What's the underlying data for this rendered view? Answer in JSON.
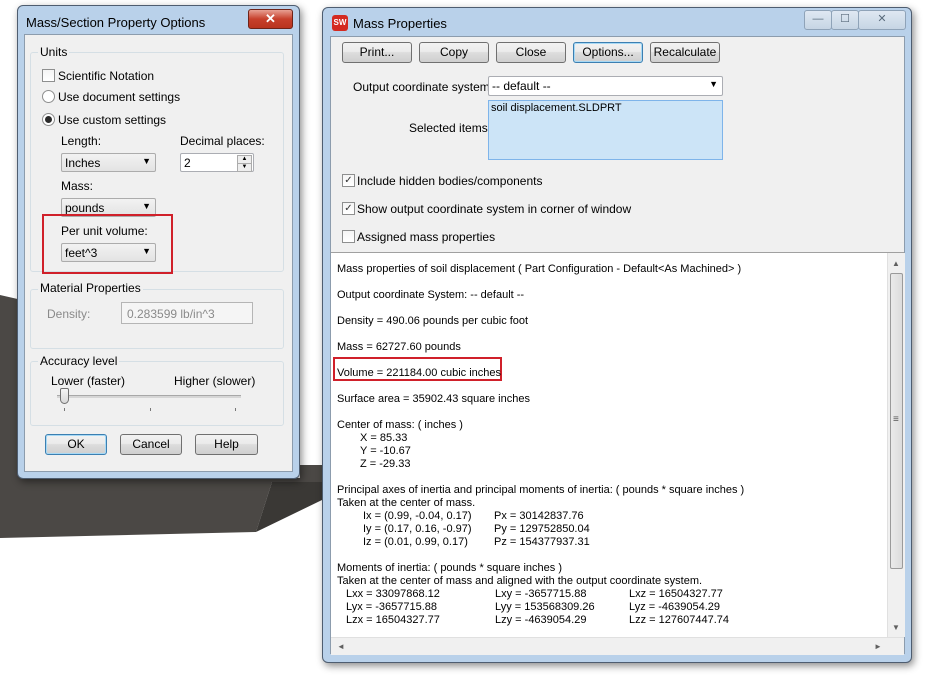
{
  "options_dialog": {
    "title": "Mass/Section Property Options",
    "close_glyph": "✕",
    "units": {
      "group_label": "Units",
      "scientific_notation": {
        "label": "Scientific Notation",
        "checked": false
      },
      "use_document_settings": {
        "label": "Use document settings",
        "selected": false
      },
      "use_custom_settings": {
        "label": "Use custom settings",
        "selected": true
      },
      "length_label": "Length:",
      "length_value": "Inches",
      "decimal_places_label": "Decimal places:",
      "decimal_places_value": "2",
      "mass_label": "Mass:",
      "mass_value": "pounds",
      "per_unit_volume_label": "Per unit volume:",
      "per_unit_volume_value": "feet^3"
    },
    "material": {
      "group_label": "Material Properties",
      "density_label": "Density:",
      "density_value": "0.283599 lb/in^3"
    },
    "accuracy": {
      "group_label": "Accuracy level",
      "lower_label": "Lower (faster)",
      "higher_label": "Higher (slower)",
      "level": 0
    },
    "buttons": {
      "ok": "OK",
      "cancel": "Cancel",
      "help": "Help"
    }
  },
  "mass_window": {
    "title": "Mass Properties",
    "app_icon": "SW",
    "caption_buttons": {
      "minimize": "—",
      "maximize": "☐",
      "close": "✕"
    },
    "toolbar": {
      "print": "Print...",
      "copy": "Copy",
      "close": "Close",
      "options": "Options...",
      "recalculate": "Recalculate"
    },
    "output_cs_label": "Output coordinate system:",
    "output_cs_value": "-- default --",
    "selected_items_label": "Selected items:",
    "selected_items": [
      "soil displacement.SLDPRT"
    ],
    "include_hidden": {
      "label": "Include hidden bodies/components",
      "checked": true
    },
    "show_output_cs": {
      "label": "Show output coordinate system in corner of window",
      "checked": true
    },
    "assigned_mass": {
      "label": "Assigned mass properties",
      "checked": false
    },
    "results": {
      "header": "Mass properties of soil displacement ( Part Configuration - Default<As Machined> )",
      "output_cs": "Output  coordinate System: -- default --",
      "density": "Density = 490.06 pounds per cubic foot",
      "mass": "Mass = 62727.60 pounds",
      "volume": "Volume = 221184.00 cubic inches",
      "surface_area": "Surface area = 35902.43 square inches",
      "center_of_mass_title": "Center of mass: ( inches )",
      "com_x": "X = 85.33",
      "com_y": "Y = -10.67",
      "com_z": "Z = -29.33",
      "principal_title": "Principal axes of inertia and principal moments of inertia: ( pounds * square inches )",
      "principal_taken": "Taken at the center of mass.",
      "ix": "Ix = (0.99, -0.04, 0.17)",
      "iy": "Iy = (0.17, 0.16, -0.97)",
      "iz": "Iz = (0.01, 0.99, 0.17)",
      "px": "Px = 30142837.76",
      "py": "Py = 129752850.04",
      "pz": "Pz = 154377937.31",
      "moments_title": "Moments of inertia: ( pounds * square inches )",
      "moments_taken": "Taken at the center of mass and aligned with the output coordinate system.",
      "lxx": "Lxx = 33097868.12",
      "lxy": "Lxy = -3657715.88",
      "lxz": "Lxz = 16504327.77",
      "lyx": "Lyx = -3657715.88",
      "lyy": "Lyy = 153568309.26",
      "lyz": "Lyz = -4639054.29",
      "lzx": "Lzx = 16504327.77",
      "lzy": "Lzy = -4639054.29",
      "lzz": "Lzz = 127607447.74"
    },
    "scroll_glyphs": {
      "up": "▲",
      "down": "▼",
      "left": "◄",
      "right": "►",
      "grip": "≡"
    }
  },
  "colors": {
    "highlight_box": "#d0202a",
    "window_frame": "#b9d1ea",
    "model_shape": "#4a4743"
  }
}
